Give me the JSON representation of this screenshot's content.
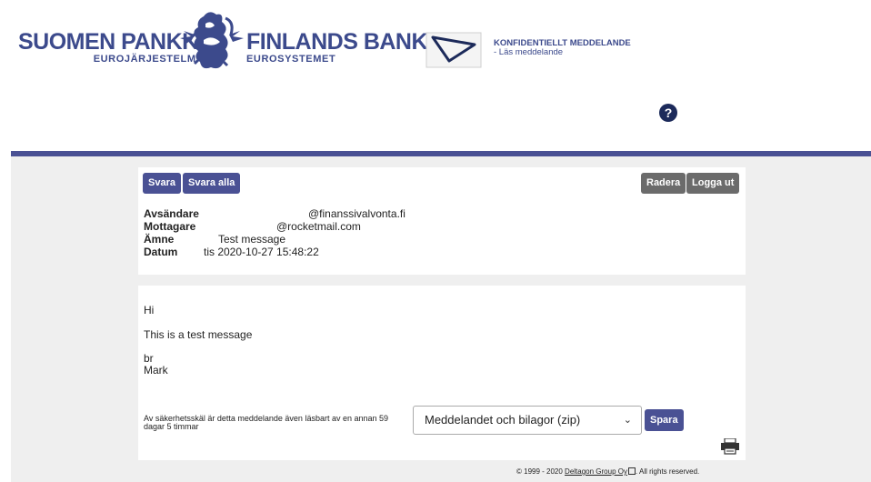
{
  "header": {
    "logo_left_big": "SUOMEN PANKKI",
    "logo_left_small": "EUROJÄRJESTELMÄ",
    "logo_right_big": "FINLANDS BANK",
    "logo_right_small": "EUROSYSTEMET",
    "confidential_title": "KONFIDENTIELLT MEDDELANDE",
    "confidential_sub": "- Läs meddelande",
    "help_label": "?"
  },
  "toolbar": {
    "reply": "Svara",
    "reply_all": "Svara alla",
    "delete": "Radera",
    "logout": "Logga ut"
  },
  "meta": {
    "sender_label": "Avsändare",
    "sender_value": "@finanssivalvonta.fi",
    "recipient_label": "Mottagare",
    "recipient_value": "@rocketmail.com",
    "subject_label": "Ämne",
    "subject_value": "Test message",
    "date_label": "Datum",
    "date_value": "tis 2020-10-27 15:48:22"
  },
  "message": {
    "line1": "Hi",
    "line2": "This is a test message",
    "line3": "br",
    "line4": "Mark"
  },
  "download": {
    "notice": "Av säkerhetsskäl är detta meddelande även läsbart av en annan 59 dagar 5 timmar",
    "selected_option": "Meddelandet och bilagor (zip)",
    "save": "Spara"
  },
  "footer": {
    "prefix": "© 1999 - 2020 ",
    "link": "Deltagon Group Oy",
    "suffix": ". All rights reserved."
  },
  "colors": {
    "brand": "#3c4a8c",
    "band": "#4a5194",
    "gray_button": "#6b6b6b"
  }
}
